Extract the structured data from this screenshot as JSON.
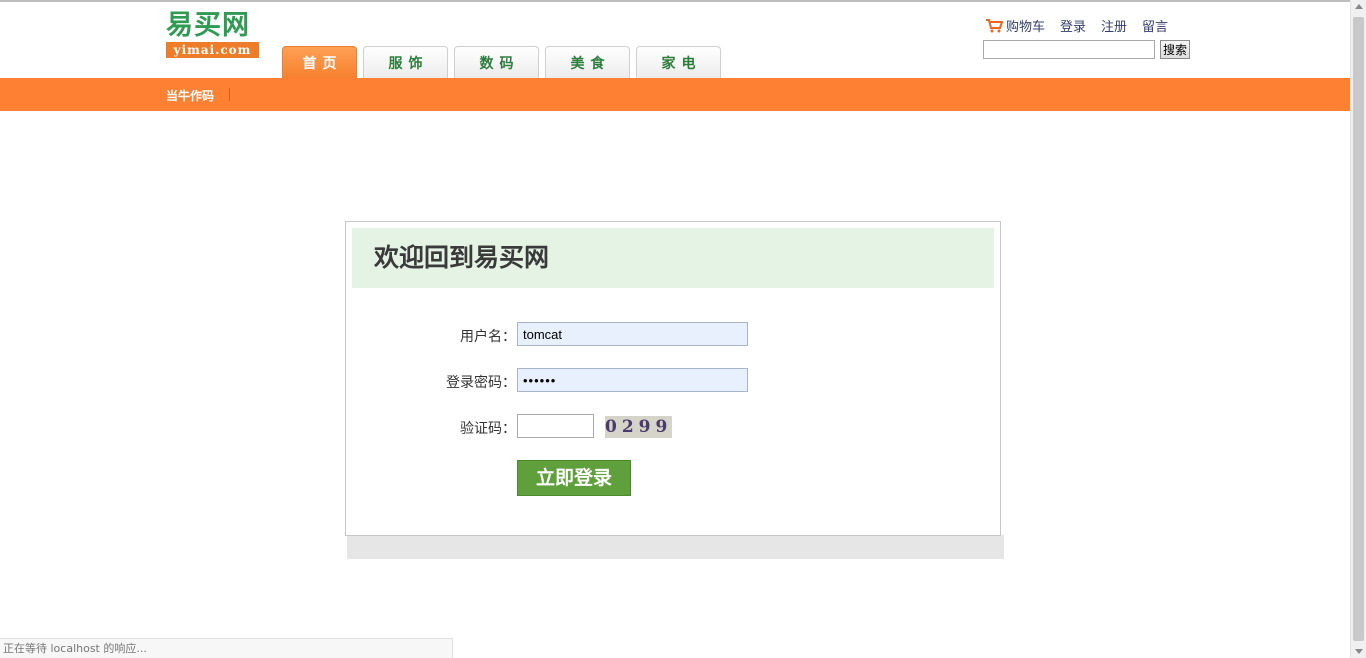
{
  "logo": {
    "cn": "易买网",
    "en": "yimai.com"
  },
  "nav": {
    "tabs": [
      {
        "label": "首页",
        "active": true
      },
      {
        "label": "服饰",
        "active": false
      },
      {
        "label": "数码",
        "active": false
      },
      {
        "label": "美食",
        "active": false
      },
      {
        "label": "家电",
        "active": false
      }
    ]
  },
  "header": {
    "cart_label": "购物车",
    "cart_icon": "cart-icon",
    "login_label": "登录",
    "register_label": "注册",
    "message_label": "留言",
    "search_value": "",
    "search_button": "搜索"
  },
  "subnav": {
    "link": "当牛作码"
  },
  "login": {
    "title": "欢迎回到易买网",
    "username_label": "用户名：",
    "username_value": "tomcat",
    "password_label": "登录密码：",
    "password_value": "••••••",
    "captcha_label": "验证码：",
    "captcha_value": "",
    "captcha_image_text": "0299",
    "submit_label": "立即登录"
  },
  "status_bar": {
    "text": "正在等待 localhost 的响应..."
  },
  "colors": {
    "accent": "#fd8033",
    "brand_green": "#2f9a52",
    "button_green": "#5fa03d",
    "panel_head": "#e5f3e5"
  }
}
